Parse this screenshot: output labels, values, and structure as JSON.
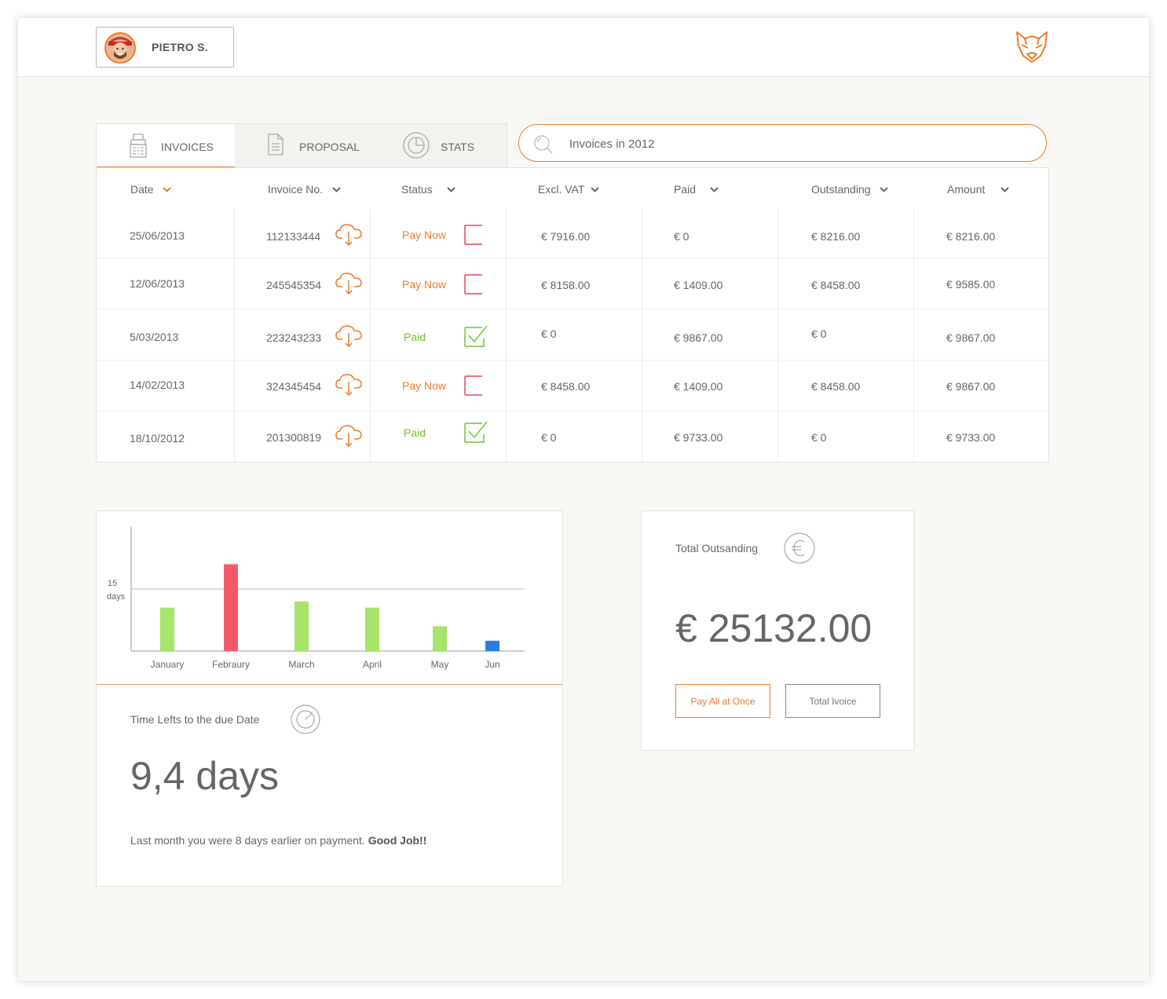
{
  "header": {
    "user_name": "PIETRO S."
  },
  "tabs": [
    {
      "label": "INVOICES",
      "icon": "register-icon",
      "active": true
    },
    {
      "label": "PROPOSAL",
      "icon": "document-icon",
      "active": false
    },
    {
      "label": "STATS",
      "icon": "pie-chart-icon",
      "active": false
    }
  ],
  "search": {
    "value": "Invoices in 2012",
    "icon": "search-icon"
  },
  "table": {
    "columns": [
      "Date",
      "Invoice No.",
      "Status",
      "Excl. VAT",
      "Paid",
      "Outstanding",
      "Amount"
    ],
    "rows": [
      {
        "date": "25/06/2013",
        "invoice": "112133444",
        "status": "Pay Now",
        "excl_vat": "€ 7916.00",
        "paid": "€ 0",
        "outstanding": "€ 8216.00",
        "amount": "€ 8216.00"
      },
      {
        "date": "12/06/2013",
        "invoice": "245545354",
        "status": "Pay Now",
        "excl_vat": "€ 8158.00",
        "paid": "€ 1409.00",
        "outstanding": "€ 8458.00",
        "amount": "€ 9585.00"
      },
      {
        "date": "5/03/2013",
        "invoice": "223243233",
        "status": "Paid",
        "excl_vat": "€ 0",
        "paid": "€ 9867.00",
        "outstanding": "€ 0",
        "amount": "€ 9867.00"
      },
      {
        "date": "14/02/2013",
        "invoice": "324345454",
        "status": "Pay Now",
        "excl_vat": "€ 8458.00",
        "paid": "€ 1409.00",
        "outstanding": "€ 8458.00",
        "amount": "€ 9867.00"
      },
      {
        "date": "18/10/2012",
        "invoice": "201300819",
        "status": "Paid",
        "excl_vat": "€ 0",
        "paid": "€ 9733.00",
        "outstanding": "€ 0",
        "amount": "€ 9733.00"
      }
    ]
  },
  "chart_data": {
    "type": "bar",
    "categories": [
      "January",
      "Febraury",
      "March",
      "April",
      "May",
      "Jun"
    ],
    "values": [
      10.5,
      21,
      12,
      10.5,
      6,
      2.5
    ],
    "colors": [
      "#a8e36a",
      "#f25a6a",
      "#a8e36a",
      "#a8e36a",
      "#a8e36a",
      "#2a7de0"
    ],
    "reference_line": {
      "value": 15,
      "label_line1": "15",
      "label_line2": "days"
    },
    "ylim": [
      0,
      30
    ]
  },
  "due": {
    "label": "Time Lefts to the due Date",
    "value": "9,4 days",
    "note": "Last month you were 8 days earlier on payment.",
    "note_bold": "Good Job!!"
  },
  "outstanding": {
    "label": "Total Outsanding",
    "value": "€ 25132.00",
    "pay_button": "Pay All at Once",
    "total_button": "Total Ivoice"
  },
  "colors": {
    "accent": "#f07a2b",
    "paid": "#72c23c",
    "unpaid_flag": "#e0485a"
  }
}
